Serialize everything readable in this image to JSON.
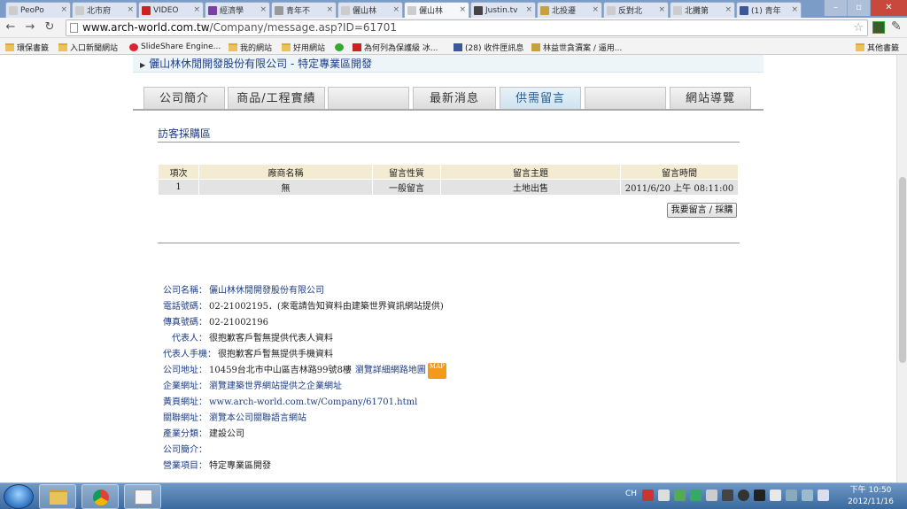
{
  "browser": {
    "tabs": [
      {
        "label": "PeoPo",
        "color": "#cccccc"
      },
      {
        "label": "北市府",
        "color": "#cccccc"
      },
      {
        "label": "VIDEO",
        "color": "#cc2222"
      },
      {
        "label": "經濟學",
        "color": "#7a3fa0"
      },
      {
        "label": "青年不",
        "color": "#999999"
      },
      {
        "label": "儷山林",
        "color": "#cccccc"
      },
      {
        "label": "儷山林",
        "color": "#cccccc"
      },
      {
        "label": "Justin.tv",
        "color": "#444444"
      },
      {
        "label": "北投遷",
        "color": "#c8a040"
      },
      {
        "label": "反對北",
        "color": "#cccccc"
      },
      {
        "label": "北攤第",
        "color": "#cccccc"
      },
      {
        "label": "(1) 青年",
        "color": "#3b5998"
      }
    ],
    "url_host": "www.arch-world.com.tw",
    "url_path": "/Company/message.asp?ID=61701",
    "bookmarks": [
      "環保書籤",
      "入口新聞網站",
      "SlideShare Engine...",
      "我的網站",
      "好用網站",
      "為何列為保護級 冰...",
      "(28) 收件匣訊息",
      "林益世貪瀆案 / 逼用...",
      "其他書籤"
    ]
  },
  "site": {
    "header": "儷山林休閒開發股份有限公司 - 特定專業區開發",
    "nav_tabs": [
      "公司簡介",
      "商品/工程實績",
      "",
      "最新消息",
      "供需留言",
      "",
      "網站導覽"
    ],
    "section_title": "訪客採購區",
    "table": {
      "headers": [
        "項次",
        "廠商名稱",
        "留言性質",
        "留言主題",
        "留言時間"
      ],
      "rows": [
        [
          "1",
          "無",
          "一般留言",
          "土地出售",
          "2011/6/20 上午 08:11:00"
        ]
      ]
    },
    "post_button": "我要留言 / 採購",
    "info": [
      {
        "label": "公司名稱：",
        "value": "儷山林休閒開發股份有限公司",
        "link": true
      },
      {
        "label": "電話號碼：",
        "value": "02-21002195．(來電請告知資料由建築世界資訊網站提供)",
        "link": false
      },
      {
        "label": "傳真號碼：",
        "value": "02-21002196",
        "link": false
      },
      {
        "label": "代表人：",
        "value": "很抱歉客戶暫無提供代表人資料",
        "link": false
      },
      {
        "label": "代表人手機：",
        "value": "很抱歉客戶暫無提供手機資料",
        "link": false
      },
      {
        "label": "公司地址：",
        "value": "10459台北市中山區吉林路99號8樓",
        "extra": "瀏覽詳細網路地圖",
        "badge": "MAP",
        "link": false
      },
      {
        "label": "企業網址：",
        "value": "瀏覽建築世界網站提供之企業網址",
        "link": true
      },
      {
        "label": "黃頁網址：",
        "value": "www.arch-world.com.tw/Company/61701.html",
        "link": true
      },
      {
        "label": "關聯網址：",
        "value": "瀏覽本公司關聯語言網站",
        "link": true
      },
      {
        "label": "產業分類：",
        "value": "建設公司",
        "link": false
      },
      {
        "label": "公司簡介：",
        "value": "",
        "link": false
      },
      {
        "label": "營業項目：",
        "value": "特定專業區開發",
        "link": false
      }
    ]
  },
  "taskbar": {
    "time": "下午 10:50",
    "date": "2012/11/16",
    "lang": "CH"
  }
}
